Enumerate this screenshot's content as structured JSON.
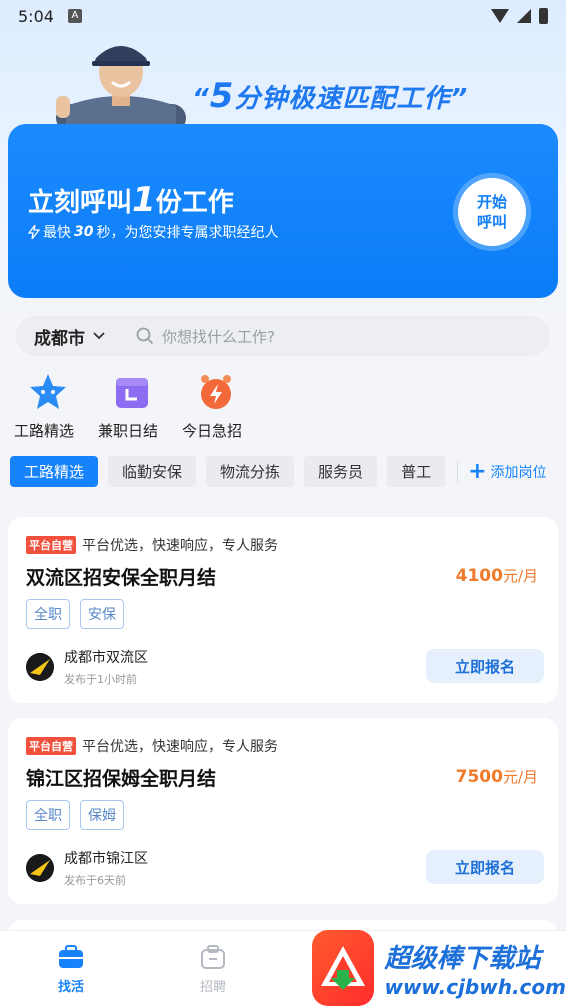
{
  "status": {
    "time": "5:04",
    "a_label": "A"
  },
  "slogan": {
    "prefix": "“",
    "num": "5",
    "text": "分钟极速匹配工作",
    "suffix": "”"
  },
  "hero": {
    "title_pre": "立刻呼叫",
    "title_num": "1",
    "title_post": "份工作",
    "sub_pre": "最快",
    "sub_num": "30",
    "sub_post": "秒，为您安排专属求职经纪人",
    "call_line1": "开始",
    "call_line2": "呼叫"
  },
  "search": {
    "city": "成都市",
    "placeholder": "你想找什么工作?"
  },
  "quick": [
    {
      "label": "工路精选",
      "icon": "star-icon"
    },
    {
      "label": "兼职日结",
      "icon": "calendar-icon"
    },
    {
      "label": "今日急招",
      "icon": "alarm-icon"
    }
  ],
  "tags": [
    "工路精选",
    "临勤安保",
    "物流分拣",
    "服务员",
    "普工"
  ],
  "add_job": "添加岗位",
  "jobs": [
    {
      "badge": "平台自营",
      "slogan": "平台优选，快速响应，专人服务",
      "title": "双流区招安保全职月结",
      "amount": "4100",
      "unit": "元/月",
      "tags": [
        "全职",
        "安保"
      ],
      "location": "成都市双流区",
      "posted": "发布于1小时前",
      "apply": "立即报名"
    },
    {
      "badge": "平台自营",
      "slogan": "平台优选，快速响应，专人服务",
      "title": "锦江区招保姆全职月结",
      "amount": "7500",
      "unit": "元/月",
      "tags": [
        "全职",
        "保姆"
      ],
      "location": "成都市锦江区",
      "posted": "发布于6天前",
      "apply": "立即报名"
    }
  ],
  "nav": [
    {
      "label": "找活",
      "active": true
    },
    {
      "label": "招聘",
      "active": false
    }
  ],
  "watermark": {
    "line1": "超级棒下载站",
    "line2": "www.cjbwh.com"
  },
  "colors": {
    "primary": "#1683fb",
    "salary": "#f07a2a",
    "badge": "#f0503c"
  }
}
